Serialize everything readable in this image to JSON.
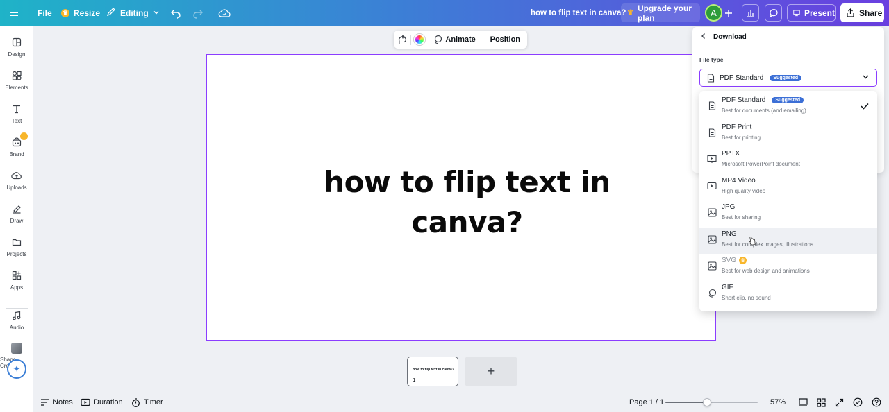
{
  "topbar": {
    "file_label": "File",
    "resize_label": "Resize",
    "editing_label": "Editing",
    "doc_title": "how to flip text in canva?",
    "upgrade_label": "Upgrade your plan",
    "avatar_initial": "A",
    "present_label": "Present",
    "share_label": "Share"
  },
  "sidebar": {
    "items": [
      {
        "label": "Design",
        "icon": "layout-icon"
      },
      {
        "label": "Elements",
        "icon": "shapes-icon"
      },
      {
        "label": "Text",
        "icon": "text-icon"
      },
      {
        "label": "Brand",
        "icon": "brand-icon"
      },
      {
        "label": "Uploads",
        "icon": "upload-cloud-icon"
      },
      {
        "label": "Draw",
        "icon": "pen-icon"
      },
      {
        "label": "Projects",
        "icon": "folder-icon"
      },
      {
        "label": "Apps",
        "icon": "apps-icon"
      },
      {
        "label": "Audio",
        "icon": "music-icon"
      },
      {
        "label": "Shape Crop...",
        "icon": "shape-crop-thumbnail"
      }
    ]
  },
  "context_toolbar": {
    "animate_label": "Animate",
    "position_label": "Position"
  },
  "canvas": {
    "heading_line1": "how to flip text in",
    "heading_line2": "canva?"
  },
  "pages": {
    "thumb_text": "how to flip text in canva?",
    "thumb_number": "1",
    "add_label": "+"
  },
  "bottombar": {
    "notes_label": "Notes",
    "duration_label": "Duration",
    "timer_label": "Timer",
    "page_indicator": "Page 1 / 1",
    "zoom_value": "57%",
    "zoom_fraction": 0.45
  },
  "download_panel": {
    "title": "Download",
    "filetype_label": "File type",
    "selected": "PDF Standard",
    "selected_badge": "Suggested",
    "options": [
      {
        "title": "PDF Standard",
        "subtitle": "Best for documents (and emailing)",
        "badge": "Suggested",
        "icon": "document-icon",
        "checked": true
      },
      {
        "title": "PDF Print",
        "subtitle": "Best for printing",
        "icon": "document-icon"
      },
      {
        "title": "PPTX",
        "subtitle": "Microsoft PowerPoint document",
        "icon": "presentation-icon"
      },
      {
        "title": "MP4 Video",
        "subtitle": "High quality video",
        "icon": "video-icon"
      },
      {
        "title": "JPG",
        "subtitle": "Best for sharing",
        "icon": "image-icon"
      },
      {
        "title": "PNG",
        "subtitle": "Best for complex images, illustrations",
        "icon": "image-icon",
        "hover": true
      },
      {
        "title": "SVG",
        "subtitle": "Best for web design and animations",
        "icon": "image-icon",
        "premium": true
      },
      {
        "title": "GIF",
        "subtitle": "Short clip, no sound",
        "icon": "gif-icon"
      }
    ]
  },
  "colors": {
    "accent_purple": "#8b3dff",
    "gradient_start": "#1fb3c8",
    "gradient_end": "#6a3fe0",
    "badge_blue": "#3c6fd6",
    "crown_gold": "#f8b62a"
  }
}
